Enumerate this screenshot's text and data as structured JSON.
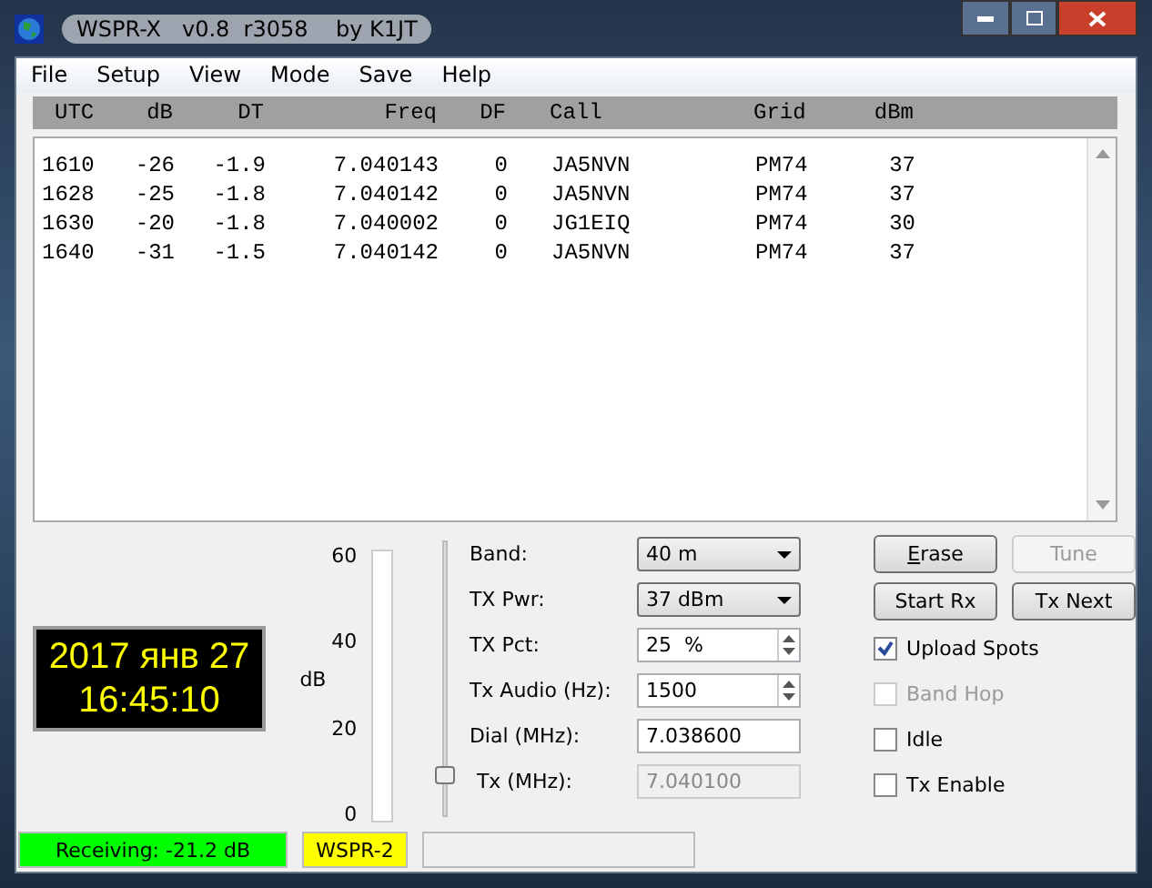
{
  "window": {
    "title": "WSPR-X   v0.8  r3058    by K1JT"
  },
  "menu": [
    "File",
    "Setup",
    "View",
    "Mode",
    "Save",
    "Help"
  ],
  "table": {
    "columns": [
      "UTC",
      "dB",
      "DT",
      "Freq",
      "DF",
      "Call",
      "Grid",
      "dBm"
    ],
    "rows": [
      [
        "1610",
        "-26",
        "-1.9",
        "7.040143",
        "0",
        "JA5NVN",
        "PM74",
        "37"
      ],
      [
        "1628",
        "-25",
        "-1.8",
        "7.040142",
        "0",
        "JA5NVN",
        "PM74",
        "37"
      ],
      [
        "1630",
        "-20",
        "-1.8",
        "7.040002",
        "0",
        "JG1EIQ",
        "PM74",
        "30"
      ],
      [
        "1640",
        "-31",
        "-1.5",
        "7.040142",
        "0",
        "JA5NVN",
        "PM74",
        "37"
      ]
    ]
  },
  "clock": {
    "date": "2017 янв 27",
    "time": "16:45:10"
  },
  "meter": {
    "label": "dB",
    "ticks": [
      "60",
      "40",
      "20",
      "0"
    ]
  },
  "gain_slider": {
    "level": 0.15
  },
  "fields": [
    {
      "label": "Band:",
      "kind": "combo",
      "value": "40 m"
    },
    {
      "label": "TX Pwr:",
      "kind": "combo",
      "value": "37 dBm"
    },
    {
      "label": "TX Pct:",
      "kind": "spin",
      "value": "25  %"
    },
    {
      "label": "Tx Audio (Hz):",
      "kind": "spin",
      "value": "1500"
    },
    {
      "label": "Dial (MHz):",
      "kind": "text",
      "value": "7.038600",
      "disabled": false
    },
    {
      "label": "Tx (MHz):",
      "kind": "text",
      "value": "7.040100",
      "disabled": true
    }
  ],
  "buttons": [
    {
      "label": "Erase",
      "disabled": false
    },
    {
      "label": "Tune",
      "disabled": true
    },
    {
      "label": "Start Rx",
      "disabled": false
    },
    {
      "label": "Tx Next",
      "disabled": false
    }
  ],
  "checkboxes": [
    {
      "label": "Upload Spots",
      "checked": true,
      "disabled": false
    },
    {
      "label": "Band Hop",
      "checked": false,
      "disabled": true
    },
    {
      "label": "Idle",
      "checked": false,
      "disabled": false
    },
    {
      "label": "Tx Enable",
      "checked": false,
      "disabled": false
    }
  ],
  "status_bar": [
    {
      "text": "Receiving: -21.2 dB",
      "color": "#00ff00"
    },
    {
      "text": "WSPR-2",
      "color": "#ffff00"
    },
    {
      "color": "#f0f0f0"
    }
  ]
}
